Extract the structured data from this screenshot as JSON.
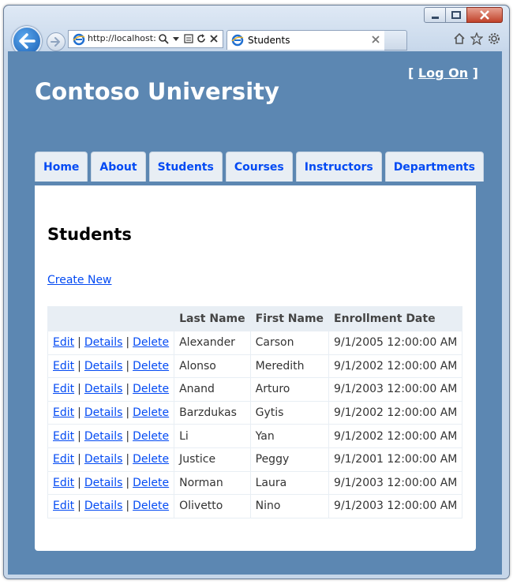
{
  "browser": {
    "address_text": "http://localhost:",
    "tab_title": "Students"
  },
  "site": {
    "logon_prefix": "[",
    "logon_link": "Log On",
    "logon_suffix": "]",
    "title": "Contoso University"
  },
  "menu": [
    {
      "label": "Home"
    },
    {
      "label": "About"
    },
    {
      "label": "Students"
    },
    {
      "label": "Courses"
    },
    {
      "label": "Instructors"
    },
    {
      "label": "Departments"
    }
  ],
  "page": {
    "title": "Students",
    "create_link": "Create New"
  },
  "table": {
    "columns": [
      "",
      "Last Name",
      "First Name",
      "Enrollment Date"
    ],
    "actions": [
      "Edit",
      "Details",
      "Delete"
    ],
    "separator": "|",
    "rows": [
      {
        "last": "Alexander",
        "first": "Carson",
        "date": "9/1/2005 12:00:00 AM"
      },
      {
        "last": "Alonso",
        "first": "Meredith",
        "date": "9/1/2002 12:00:00 AM"
      },
      {
        "last": "Anand",
        "first": "Arturo",
        "date": "9/1/2003 12:00:00 AM"
      },
      {
        "last": "Barzdukas",
        "first": "Gytis",
        "date": "9/1/2002 12:00:00 AM"
      },
      {
        "last": "Li",
        "first": "Yan",
        "date": "9/1/2002 12:00:00 AM"
      },
      {
        "last": "Justice",
        "first": "Peggy",
        "date": "9/1/2001 12:00:00 AM"
      },
      {
        "last": "Norman",
        "first": "Laura",
        "date": "9/1/2003 12:00:00 AM"
      },
      {
        "last": "Olivetto",
        "first": "Nino",
        "date": "9/1/2003 12:00:00 AM"
      }
    ]
  },
  "colors": {
    "page_background": "#5c87b2",
    "link": "#034af3",
    "menu_background": "#e8eef4"
  }
}
